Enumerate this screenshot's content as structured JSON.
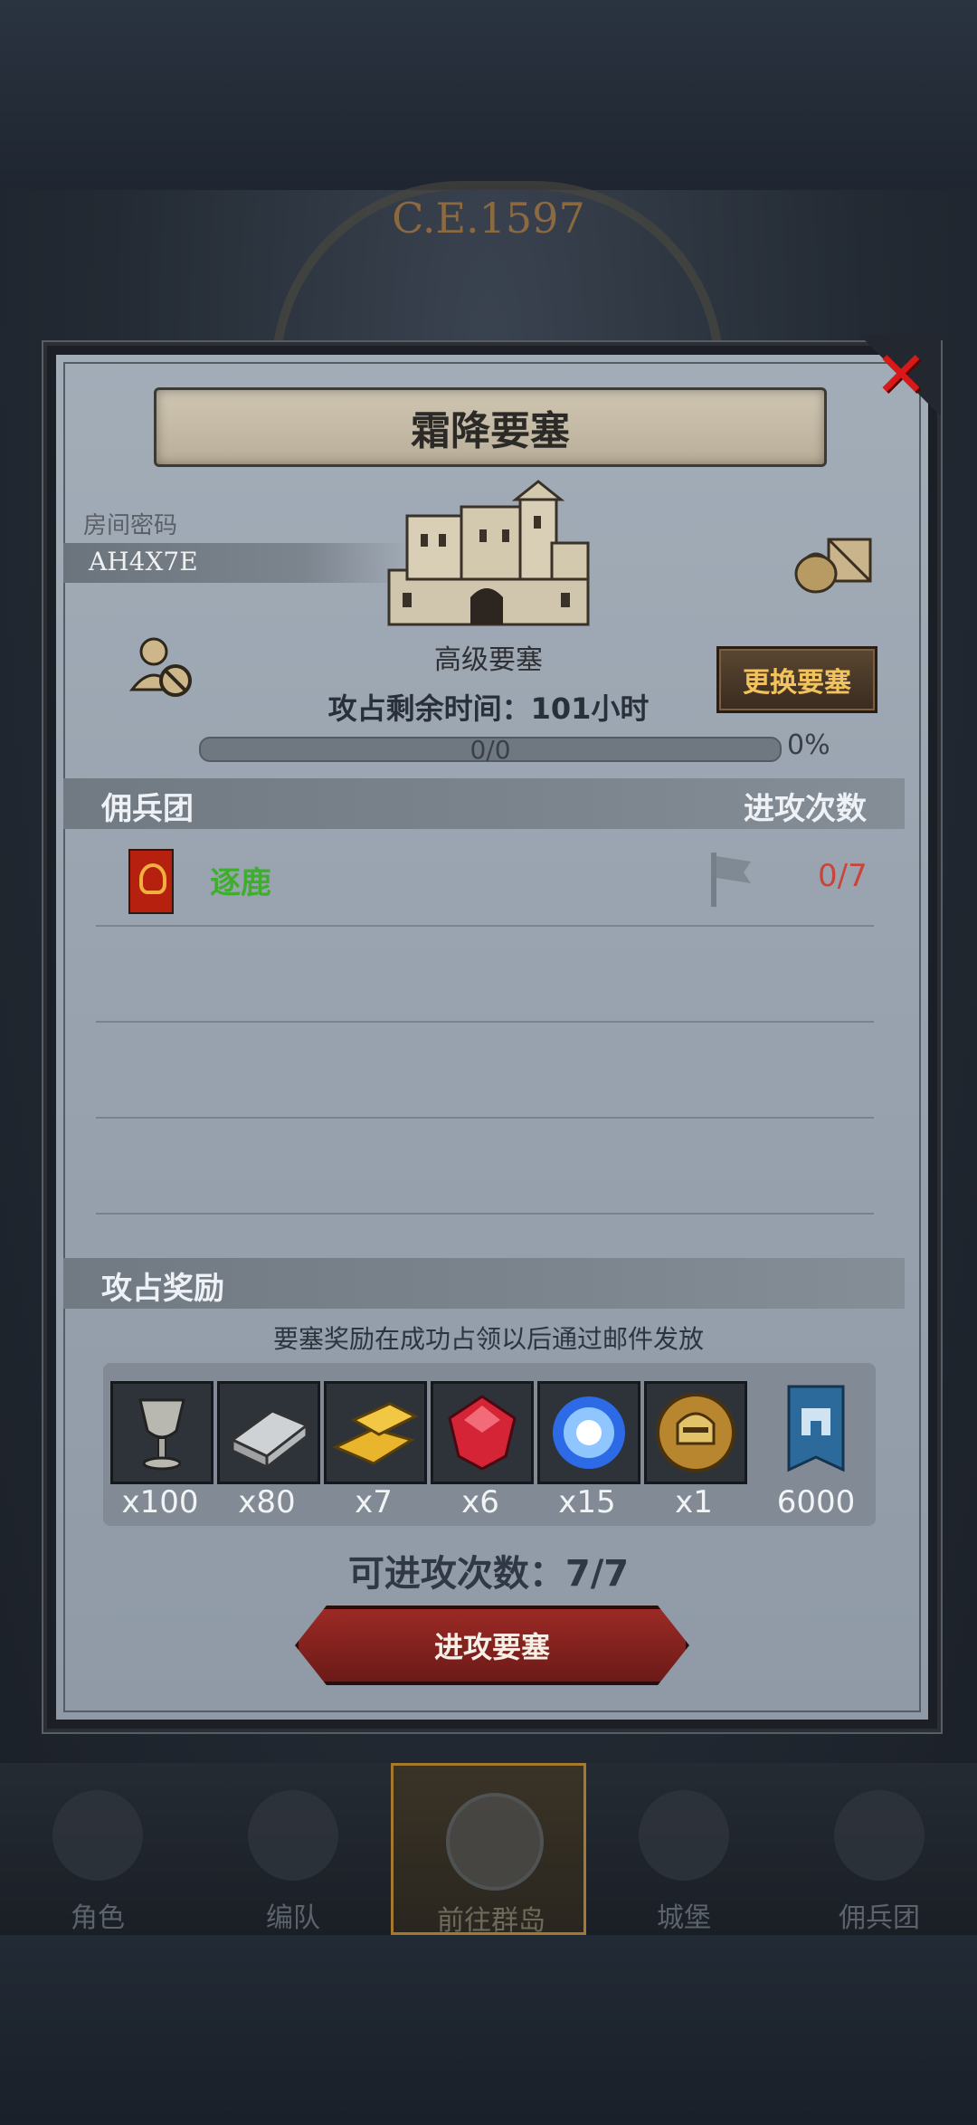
{
  "background": {
    "year_label": "C.E.1597"
  },
  "modal": {
    "title": "霜降要塞",
    "close_label": "✕",
    "room_label": "房间密码",
    "room_code": "AH4X7E",
    "fortress_level": "高级要塞",
    "time_remaining_label": "攻占剩余时间：",
    "time_remaining_value": "101小时",
    "change_button": "更换要塞",
    "progress_text": "0/0",
    "progress_percent": "0%",
    "progress_fraction": 0
  },
  "mercenary_section": {
    "title": "佣兵团",
    "attacks_header": "进攻次数",
    "rows": [
      {
        "name": "逐鹿",
        "attacks": "0/7"
      }
    ]
  },
  "reward_section": {
    "title": "攻占奖励",
    "note": "要塞奖励在成功占领以后通过邮件发放",
    "items": [
      {
        "icon": "chalice-icon",
        "qty": "x100"
      },
      {
        "icon": "iron-ingot-icon",
        "qty": "x80"
      },
      {
        "icon": "gold-bars-icon",
        "qty": "x7"
      },
      {
        "icon": "ruby-icon",
        "qty": "x6"
      },
      {
        "icon": "blue-crystal-icon",
        "qty": "x15"
      },
      {
        "icon": "helmet-medal-icon",
        "qty": "x1"
      },
      {
        "icon": "fortress-banner-icon",
        "qty": "6000"
      }
    ]
  },
  "attempts_label": "可进攻次数：7/7",
  "attack_button": "进攻要塞",
  "bottom_nav": [
    {
      "label": "角色",
      "icon": "knight-icon"
    },
    {
      "label": "编队",
      "icon": "helmet-icon"
    },
    {
      "label": "前往群岛",
      "icon": "compass-map-icon",
      "active": true
    },
    {
      "label": "城堡",
      "icon": "castle-icon"
    },
    {
      "label": "佣兵团",
      "icon": "mercenary-icon"
    }
  ],
  "colors": {
    "guild_name": "#3fae2f",
    "attack_count": "#c8453a",
    "close_x": "#d91818",
    "change_button_text": "#f2c25d"
  }
}
